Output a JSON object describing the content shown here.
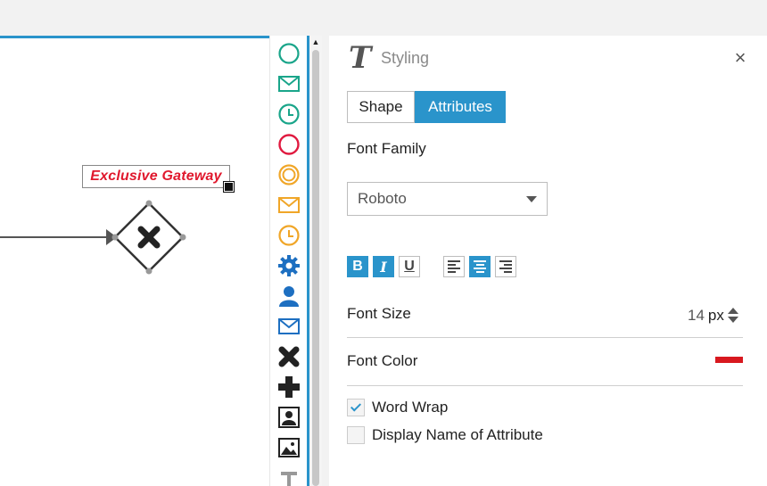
{
  "canvas": {
    "gateway_label": "Exclusive Gateway",
    "label_color": "#e0182d",
    "icons": [
      "sequence-line-icon",
      "exclusive-gateway-icon",
      "resize-handle-icon"
    ]
  },
  "palette": {
    "items": [
      {
        "name": "start-event-icon",
        "color": "#1aa58a"
      },
      {
        "name": "message-start-event-icon",
        "color": "#1aa58a"
      },
      {
        "name": "timer-start-event-icon",
        "color": "#1aa58a"
      },
      {
        "name": "end-event-icon",
        "color": "#e0193f"
      },
      {
        "name": "intermediate-event-icon",
        "color": "#f0a628"
      },
      {
        "name": "message-intermediate-event-icon",
        "color": "#f0a628"
      },
      {
        "name": "timer-intermediate-event-icon",
        "color": "#f0a628"
      },
      {
        "name": "service-task-icon",
        "color": "#1d6fc1"
      },
      {
        "name": "user-task-icon",
        "color": "#1d6fc1"
      },
      {
        "name": "send-task-icon",
        "color": "#1d6fc1"
      },
      {
        "name": "exclusive-gateway-icon",
        "color": "#222222"
      },
      {
        "name": "parallel-gateway-icon",
        "color": "#222222"
      },
      {
        "name": "person-image-icon",
        "color": "#222222"
      },
      {
        "name": "image-icon",
        "color": "#222222"
      },
      {
        "name": "text-icon",
        "color": "#222222"
      }
    ],
    "scroll_up": "▲"
  },
  "panel": {
    "title": "Styling",
    "styling_icon": "T",
    "close_label": "×",
    "tabs": [
      {
        "label": "Shape",
        "active": false
      },
      {
        "label": "Attributes",
        "active": true
      }
    ],
    "font_family_label": "Font Family",
    "font_family_value": "Roboto",
    "format": {
      "bold": {
        "label": "B",
        "active": true
      },
      "italic": {
        "label": "I",
        "active": true
      },
      "underline": {
        "label": "U",
        "active": false
      },
      "align_left": {
        "active": false
      },
      "align_center": {
        "active": true
      },
      "align_right": {
        "active": false
      }
    },
    "font_size_label": "Font Size",
    "font_size_value": "14",
    "font_size_unit": "px",
    "font_color_label": "Font Color",
    "font_color_value": "#d8181f",
    "word_wrap_label": "Word Wrap",
    "word_wrap_checked": true,
    "display_name_label": "Display Name of Attribute",
    "display_name_checked": false
  },
  "colors": {
    "accent": "#2a94cb"
  }
}
